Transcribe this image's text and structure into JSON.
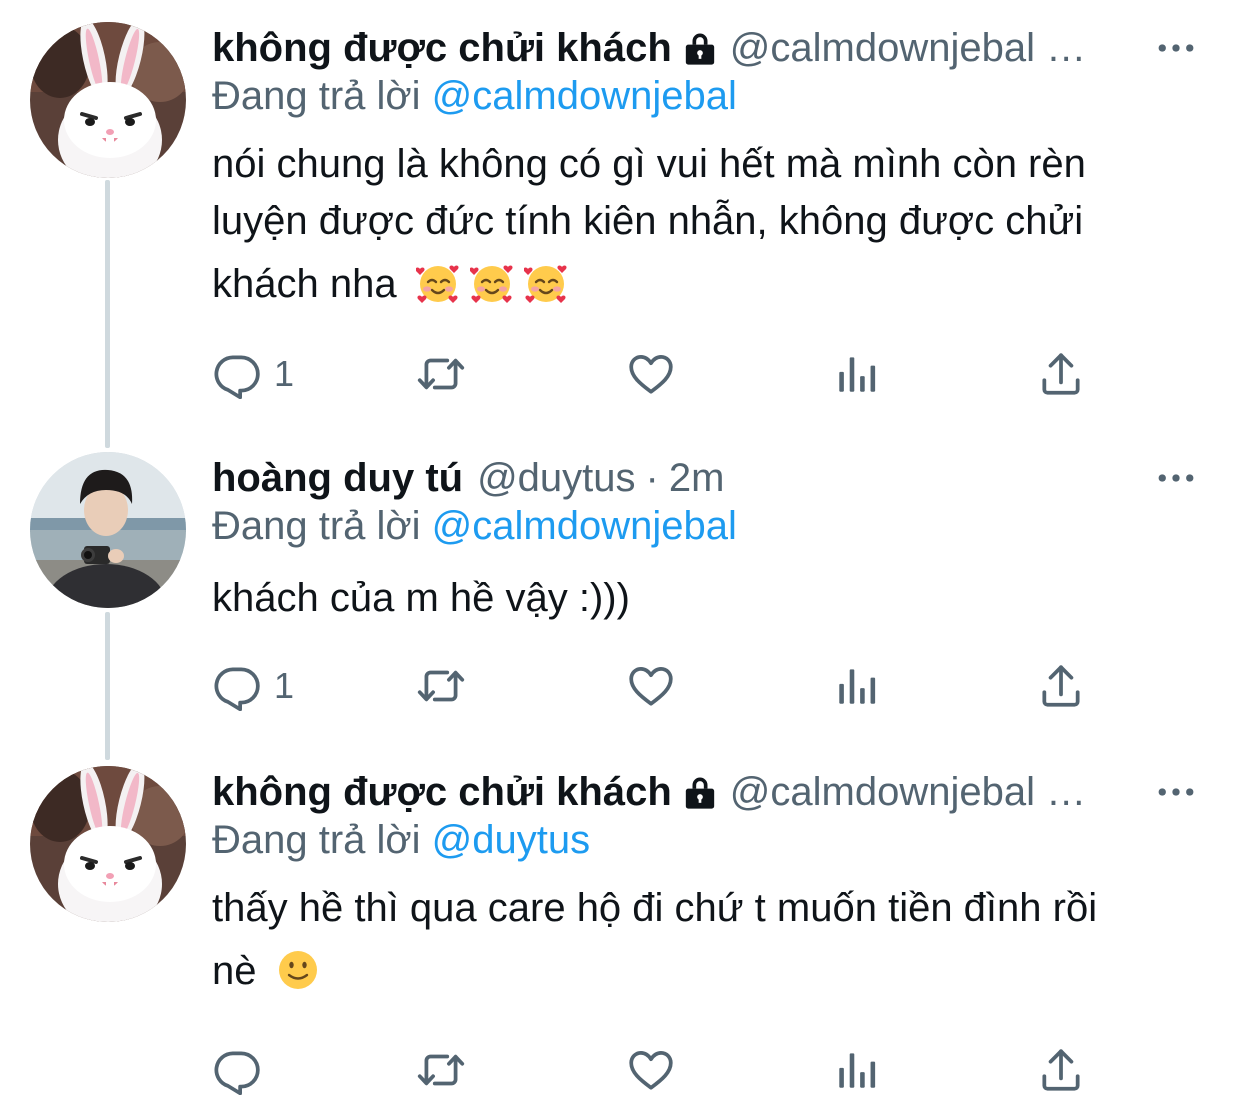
{
  "colors": {
    "text": "#0f1419",
    "secondary": "#536471",
    "link": "#1d9bf0",
    "thread_line": "#cfd9de"
  },
  "icons": {
    "reply": "reply-icon",
    "retweet": "retweet-icon",
    "like": "heart-icon",
    "analytics": "analytics-icon",
    "share": "share-icon",
    "more": "more-icon",
    "protected": "lock-icon"
  },
  "tweets": [
    {
      "name": "không được chửi khách",
      "handle": "@calmdownjebal …",
      "protected": true,
      "replying_prefix": "Đang trả lời",
      "replying_to": "@calmdownjebal",
      "text_lines": [
        "nói chung là không có gì vui hết mà mình còn rèn",
        "luyện được đức tính kiên nhẫn, không được chửi",
        "khách nha"
      ],
      "emoji": "smiling-face-with-hearts",
      "reply_count": "1"
    },
    {
      "name": "hoàng duy tú",
      "handle": "@duytus",
      "time": "2m",
      "replying_prefix": "Đang trả lời",
      "replying_to": "@calmdownjebal",
      "text_lines": [
        "khách của m hề vậy :)))"
      ],
      "reply_count": "1"
    },
    {
      "name": "không được chửi khách",
      "handle": "@calmdownjebal …",
      "protected": true,
      "replying_prefix": "Đang trả lời",
      "replying_to": "@duytus",
      "text_lines": [
        "thấy hề thì qua care hộ đi chứ t muốn tiền đình rồi",
        "nè"
      ],
      "emoji": "slightly-smiling-face",
      "reply_count": ""
    }
  ]
}
